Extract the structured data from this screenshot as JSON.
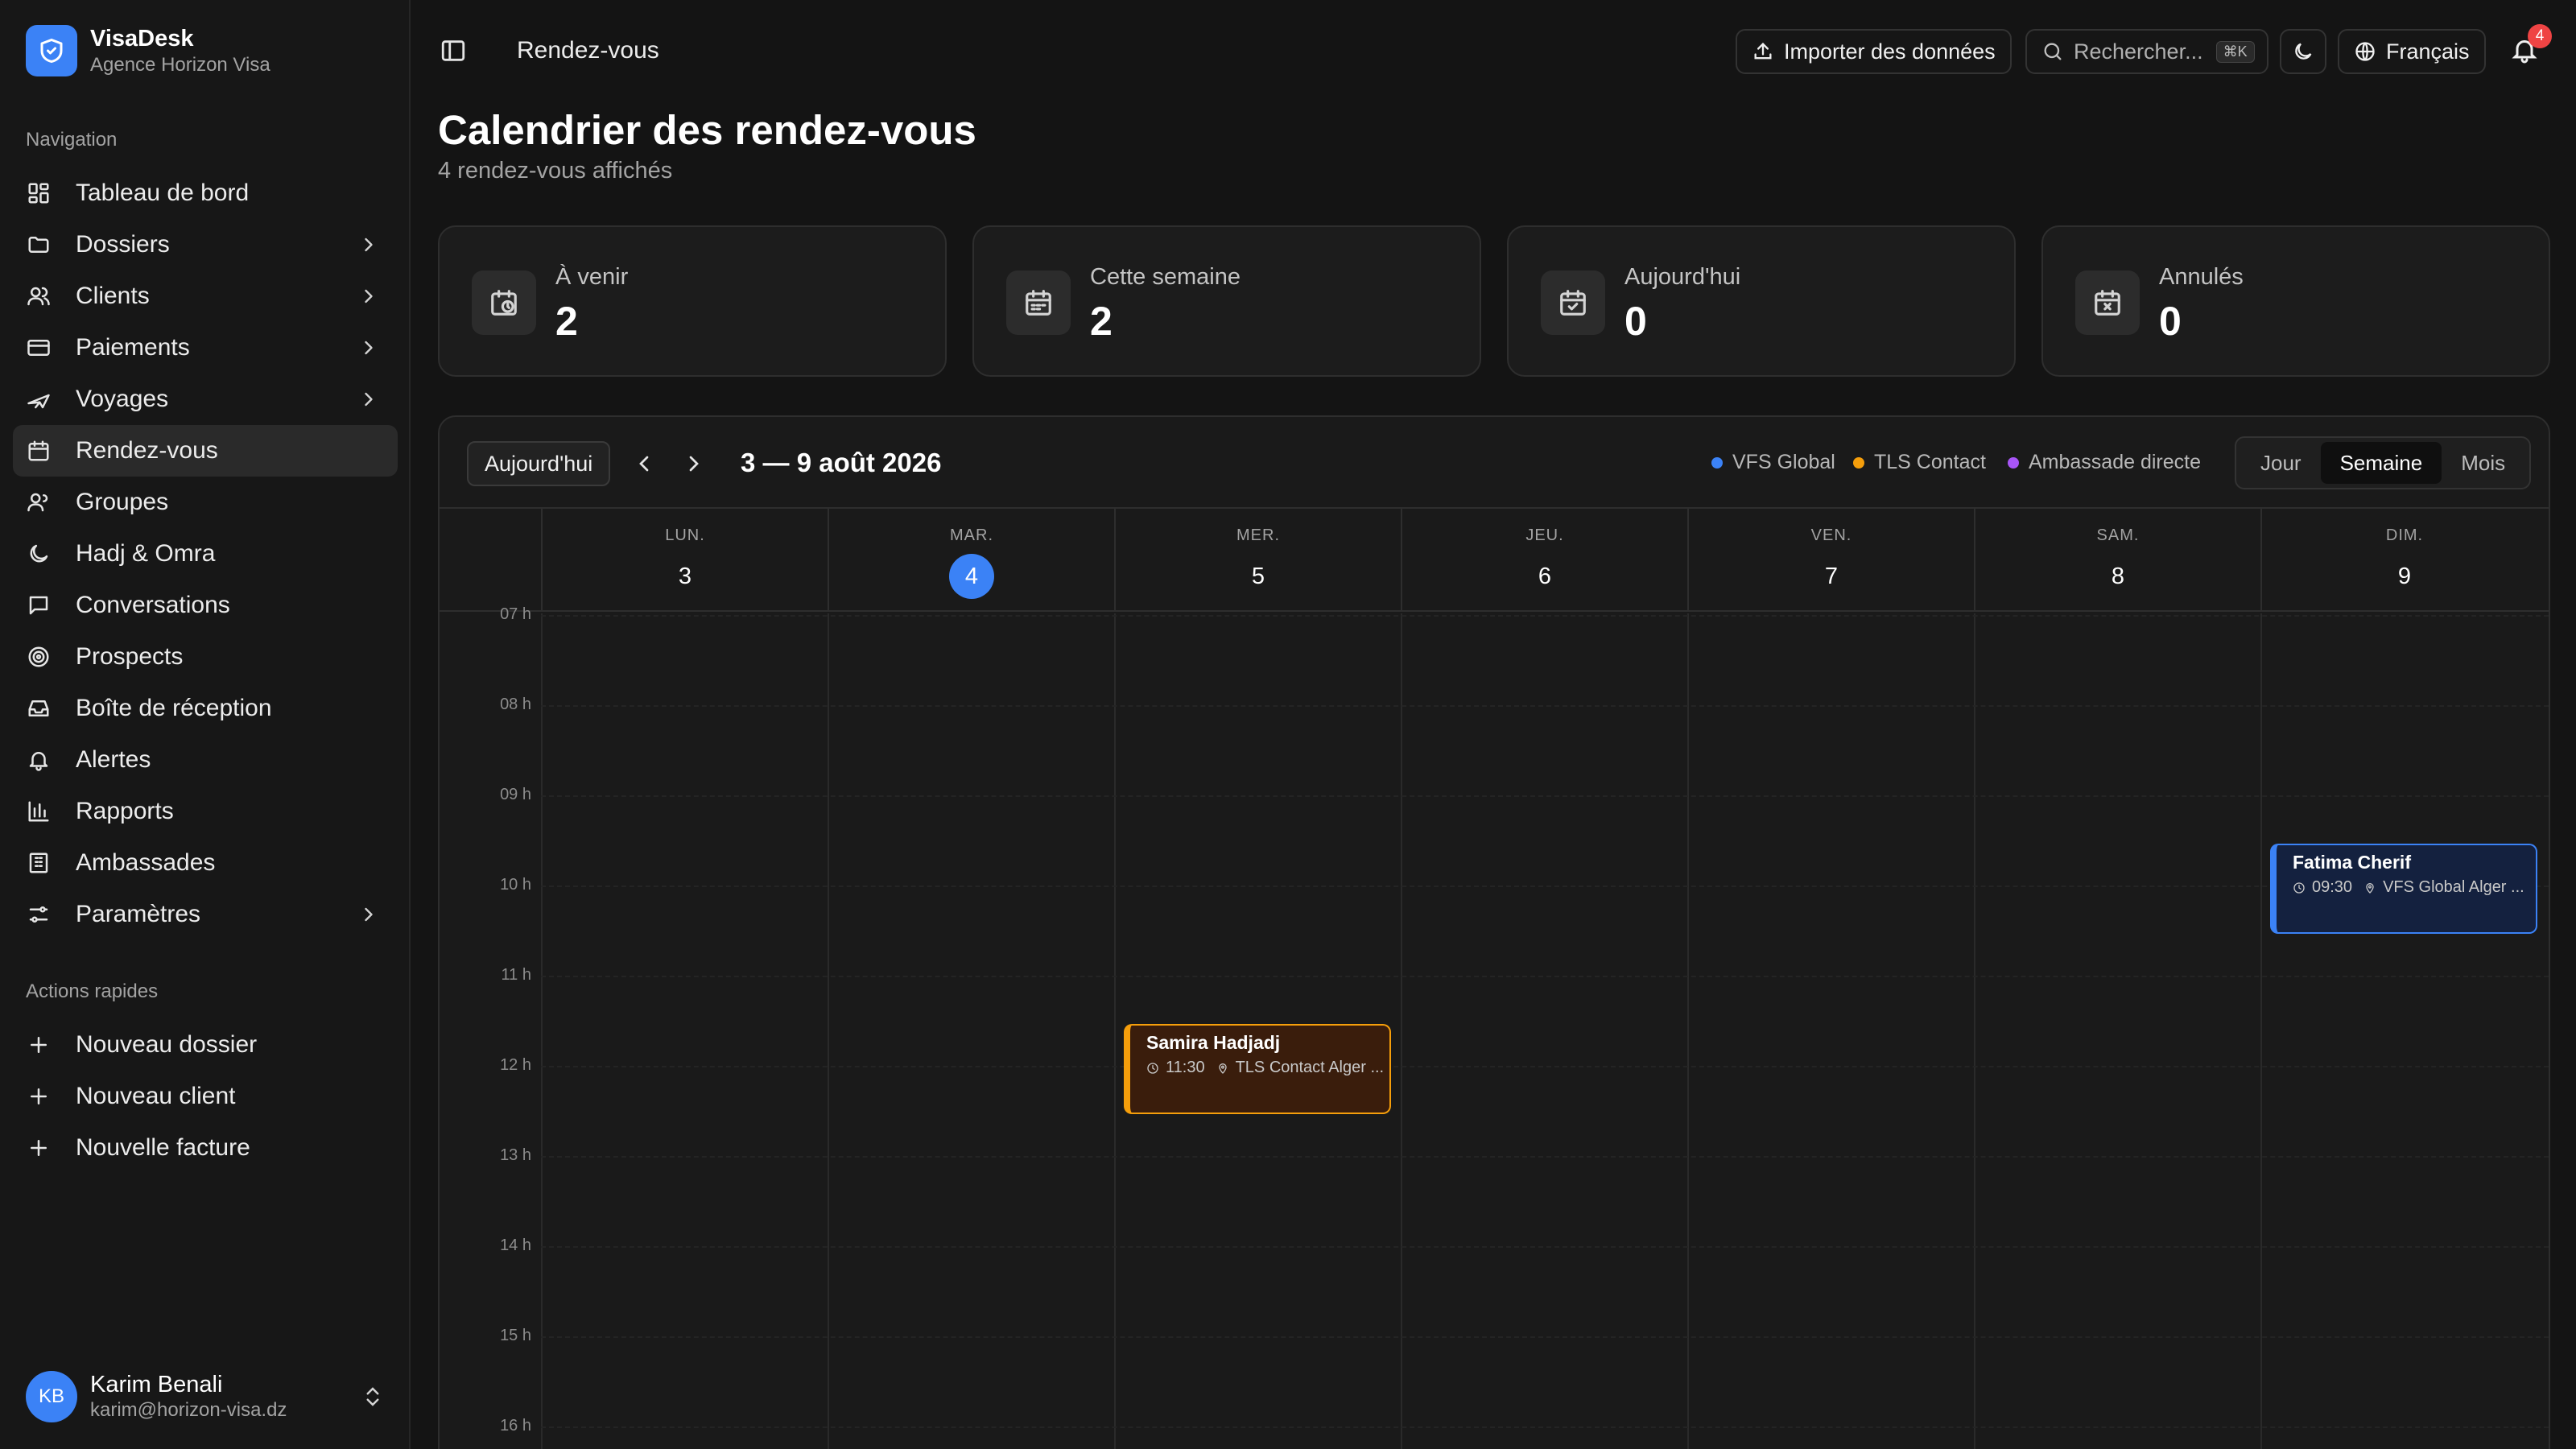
{
  "brand": {
    "name": "VisaDesk",
    "subtitle": "Agence Horizon Visa",
    "color": "#3b82f6"
  },
  "sidebar": {
    "nav_label": "Navigation",
    "items": [
      {
        "label": "Tableau de bord",
        "icon": "dashboard-icon",
        "chevron": false
      },
      {
        "label": "Dossiers",
        "icon": "folder-icon",
        "chevron": true
      },
      {
        "label": "Clients",
        "icon": "users-icon",
        "chevron": true
      },
      {
        "label": "Paiements",
        "icon": "credit-card-icon",
        "chevron": true
      },
      {
        "label": "Voyages",
        "icon": "plane-icon",
        "chevron": true
      },
      {
        "label": "Rendez-vous",
        "icon": "calendar-icon",
        "chevron": false,
        "active": true
      },
      {
        "label": "Groupes",
        "icon": "group-icon",
        "chevron": false
      },
      {
        "label": "Hadj & Omra",
        "icon": "moon-icon",
        "chevron": false
      },
      {
        "label": "Conversations",
        "icon": "chat-icon",
        "chevron": false
      },
      {
        "label": "Prospects",
        "icon": "target-icon",
        "chevron": false
      },
      {
        "label": "Boîte de réception",
        "icon": "inbox-icon",
        "chevron": false
      },
      {
        "label": "Alertes",
        "icon": "bell-icon",
        "chevron": false
      },
      {
        "label": "Rapports",
        "icon": "bar-chart-icon",
        "chevron": false
      },
      {
        "label": "Ambassades",
        "icon": "building-icon",
        "chevron": false
      },
      {
        "label": "Paramètres",
        "icon": "settings-icon",
        "chevron": true
      }
    ],
    "quick_label": "Actions rapides",
    "quick": [
      {
        "label": "Nouveau dossier"
      },
      {
        "label": "Nouveau client"
      },
      {
        "label": "Nouvelle facture"
      }
    ]
  },
  "user": {
    "initials": "KB",
    "name": "Karim Benali",
    "email": "karim@horizon-visa.dz"
  },
  "header": {
    "breadcrumb": "Rendez-vous",
    "import_label": "Importer des données",
    "search_placeholder": "Rechercher...",
    "search_shortcut": "⌘K",
    "language": "Français",
    "notifications": "4"
  },
  "page": {
    "title": "Calendrier des rendez-vous",
    "subtitle": "4 rendez-vous affichés"
  },
  "stats": [
    {
      "label": "À venir",
      "value": "2",
      "icon": "calendar-clock-icon"
    },
    {
      "label": "Cette semaine",
      "value": "2",
      "icon": "calendar-week-icon"
    },
    {
      "label": "Aujourd'hui",
      "value": "0",
      "icon": "calendar-check-icon"
    },
    {
      "label": "Annulés",
      "value": "0",
      "icon": "calendar-x-icon"
    }
  ],
  "calendar": {
    "today_label": "Aujourd'hui",
    "range": "3 — 9 août 2026",
    "legend": [
      {
        "label": "VFS Global",
        "color": "#3b82f6"
      },
      {
        "label": "TLS Contact",
        "color": "#f59e0b"
      },
      {
        "label": "Ambassade directe",
        "color": "#a855f7"
      }
    ],
    "views": [
      {
        "label": "Jour",
        "active": false
      },
      {
        "label": "Semaine",
        "active": true
      },
      {
        "label": "Mois",
        "active": false
      }
    ],
    "days": [
      {
        "name": "LUN.",
        "num": "3",
        "today": false
      },
      {
        "name": "MAR.",
        "num": "4",
        "today": true
      },
      {
        "name": "MER.",
        "num": "5",
        "today": false
      },
      {
        "name": "JEU.",
        "num": "6",
        "today": false
      },
      {
        "name": "VEN.",
        "num": "7",
        "today": false
      },
      {
        "name": "SAM.",
        "num": "8",
        "today": false
      },
      {
        "name": "DIM.",
        "num": "9",
        "today": false
      }
    ],
    "hours": [
      "07 h",
      "08 h",
      "09 h",
      "10 h",
      "11 h",
      "12 h",
      "13 h",
      "14 h",
      "15 h",
      "16 h"
    ],
    "events": [
      {
        "name": "Samira Hadjadj",
        "time": "11:30",
        "place": "TLS Contact Alger ...",
        "day": 2,
        "start": 11.5,
        "end": 12.5,
        "provider": "tls"
      },
      {
        "name": "Fatima Cherif",
        "time": "09:30",
        "place": "VFS Global Alger ...",
        "day": 6,
        "start": 9.5,
        "end": 10.5,
        "provider": "vfs"
      }
    ]
  }
}
